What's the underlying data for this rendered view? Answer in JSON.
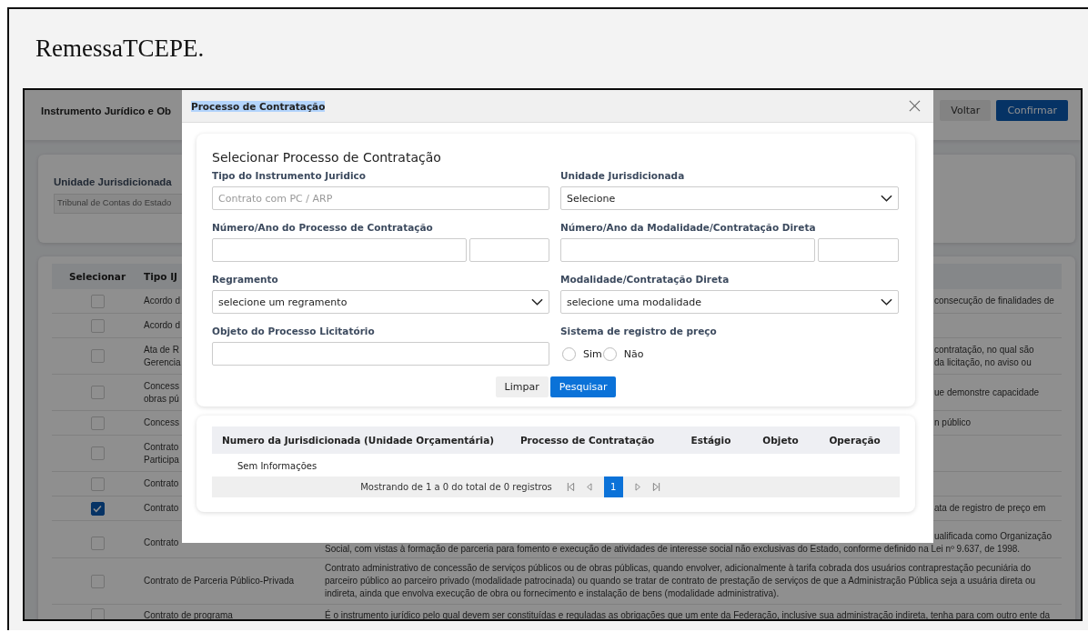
{
  "browser_page": {
    "title": "RemessaTCEPE."
  },
  "page": {
    "title": "Instrumento Jurídico e Ob",
    "buttons": [
      {
        "label": "Voltar",
        "kind": "secondary"
      },
      {
        "label": "Confirmar",
        "kind": "primary"
      }
    ],
    "filter": {
      "label": "Unidade Jurisdicionada",
      "value": "Tribunal de Contas do Estado"
    },
    "table": {
      "columns": [
        "Selecionar",
        "Tipo IJ"
      ],
      "rows": [
        {
          "checked": false,
          "tipo": [
            "Acordo d"
          ],
          "description": [
            {
              "text": "consecução de finalidades de",
              "clipped": true
            }
          ]
        },
        {
          "checked": false,
          "tipo": [
            "Acordo d"
          ],
          "description": []
        },
        {
          "checked": false,
          "tipo": [
            "Ata de R",
            "Gerencia"
          ],
          "description": [
            {
              "text": "contratação, no qual são",
              "clipped": true
            },
            {
              "text": "da licitação, no aviso ou",
              "clipped": true
            }
          ]
        },
        {
          "checked": false,
          "tipo": [
            "Concess",
            "obras pú"
          ],
          "description": [
            {
              "text": "ue demonstre capacidade",
              "clipped": true
            }
          ]
        },
        {
          "checked": false,
          "tipo": [
            "Concess"
          ],
          "description": [
            {
              "text": "n público",
              "clipped": true
            }
          ]
        },
        {
          "checked": false,
          "tipo": [
            "Contrato",
            "Participa"
          ],
          "description": []
        },
        {
          "checked": false,
          "tipo": [
            "Contrato"
          ],
          "description": []
        },
        {
          "checked": true,
          "tipo": [
            "Contrato"
          ],
          "description": [
            {
              "text": "ata de registro de preço em",
              "clipped": true
            }
          ]
        },
        {
          "checked": false,
          "tipo": [
            "Contrato"
          ],
          "description": [
            {
              "text": "ualificada como Organização",
              "clipped": true
            },
            {
              "text": "Social, com vistas à formação de parceria para fomento e execução de atividades de interesse social não exclusivas do Estado, conforme definido na Lei nº 9.637, de 1998.",
              "clipped": false
            }
          ]
        },
        {
          "checked": false,
          "tipo": [
            "Contrato de Parceria Público-Privada"
          ],
          "description": [
            {
              "text": "Contrato administrativo de concessão de serviços públicos ou de obras públicas, quando envolver, adicionalmente à tarifa cobrada dos usuários contraprestação pecuniária do parceiro público ao parceiro privado (modalidade patrocinada) ou quando se tratar de contrato de prestação de serviços de que a Administração Pública seja a usuária direta ou indireta, ainda que envolva execução de obra ou fornecimento e instalação de bens (modalidade administrativa).",
              "clipped": false
            }
          ]
        },
        {
          "checked": false,
          "tipo": [
            "Contrato de programa"
          ],
          "description": [
            {
              "text": "É o instrumento jurídico pelo qual devem ser constituídas e reguladas as obrigações que um ente da Federação, inclusive sua administração indireta, tenha para com outro ente da",
              "clipped": false
            }
          ]
        }
      ]
    }
  },
  "modal": {
    "title": "Processo de Contratação",
    "title_highlighted": true,
    "form": {
      "heading": "Selecionar Processo de Contratação",
      "fields": [
        {
          "kind": "text",
          "label": "Tipo do Instrumento Juridico",
          "placeholder": "Contrato com PC / ARP"
        },
        {
          "kind": "select",
          "label": "Unidade Jurisdicionada",
          "value": "Selecione"
        },
        {
          "kind": "pair",
          "label": "Número/Ano do Processo de Contratação"
        },
        {
          "kind": "pair",
          "label": "Número/Ano da Modalidade/Contratação Direta"
        },
        {
          "kind": "select",
          "label": "Regramento",
          "value": "selecione um regramento"
        },
        {
          "kind": "select",
          "label": "Modalidade/Contratação Direta",
          "value": "selecione uma modalidade"
        },
        {
          "kind": "text",
          "label": "Objeto do Processo Licitatório"
        },
        {
          "kind": "radio",
          "label": "Sistema de registro de preço",
          "options": [
            {
              "label": "Sim",
              "selected": false
            },
            {
              "label": "Não",
              "selected": false
            }
          ]
        }
      ],
      "buttons": [
        {
          "label": "Limpar",
          "kind": "secondary"
        },
        {
          "label": "Pesquisar",
          "kind": "primary"
        }
      ]
    },
    "results": {
      "columns": [
        "Numero da Jurisdicionada (Unidade Orçamentária)",
        "Processo de Contratação",
        "Estágio",
        "Objeto",
        "Operação"
      ],
      "empty_text": "Sem Informações",
      "pagination": {
        "summary": "Mostrando de 1 a 0 do total de 0 registros",
        "pages": [
          {
            "label": "1",
            "selected": true
          }
        ]
      }
    }
  }
}
